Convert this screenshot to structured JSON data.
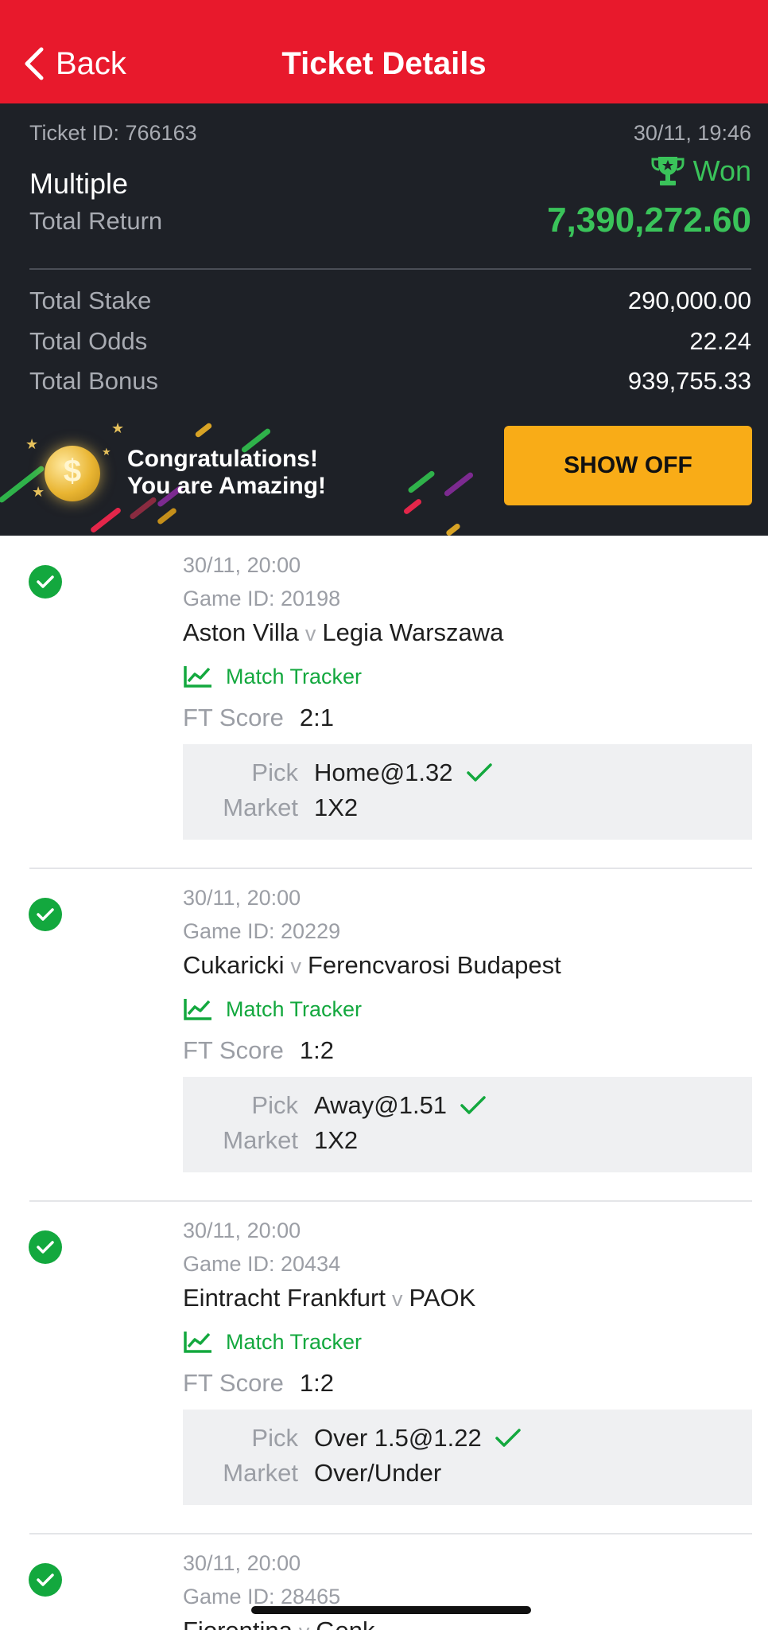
{
  "header": {
    "back_label": "Back",
    "title": "Ticket Details",
    "bg_color": "#e8192c"
  },
  "summary": {
    "ticket_id": "Ticket ID: 766163",
    "time": "30/11, 19:46",
    "type": "Multiple",
    "status": "Won",
    "total_return_label": "Total Return",
    "total_return": "7,390,272.60",
    "total_stake_label": "Total Stake",
    "total_stake": "290,000.00",
    "total_odds_label": "Total Odds",
    "total_odds": "22.24",
    "total_bonus_label": "Total Bonus",
    "total_bonus": "939,755.33",
    "accent_color": "#3ac35a"
  },
  "banner": {
    "line1": "Congratulations!",
    "line2": "You are Amazing!",
    "button": "SHOW OFF",
    "button_color": "#f9ac17"
  },
  "selections": [
    {
      "date": "30/11, 20:00",
      "game_id": "Game ID: 20198",
      "home": "Aston Villa",
      "vs": "v",
      "away": "Legia Warszawa",
      "tracker": "Match Tracker",
      "ft_label": "FT Score",
      "ft_score": "2:1",
      "pick_label": "Pick",
      "pick": "Home@1.32",
      "market_label": "Market",
      "market": "1X2"
    },
    {
      "date": "30/11, 20:00",
      "game_id": "Game ID: 20229",
      "home": "Cukaricki",
      "vs": "v",
      "away": "Ferencvarosi Budapest",
      "tracker": "Match Tracker",
      "ft_label": "FT Score",
      "ft_score": "1:2",
      "pick_label": "Pick",
      "pick": "Away@1.51",
      "market_label": "Market",
      "market": "1X2"
    },
    {
      "date": "30/11, 20:00",
      "game_id": "Game ID: 20434",
      "home": "Eintracht Frankfurt",
      "vs": "v",
      "away": "PAOK",
      "tracker": "Match Tracker",
      "ft_label": "FT Score",
      "ft_score": "1:2",
      "pick_label": "Pick",
      "pick": "Over 1.5@1.22",
      "market_label": "Market",
      "market": "Over/Under"
    },
    {
      "date": "30/11, 20:00",
      "game_id": "Game ID: 28465",
      "home": "Fiorentina",
      "vs": "v",
      "away": "Genk"
    }
  ]
}
